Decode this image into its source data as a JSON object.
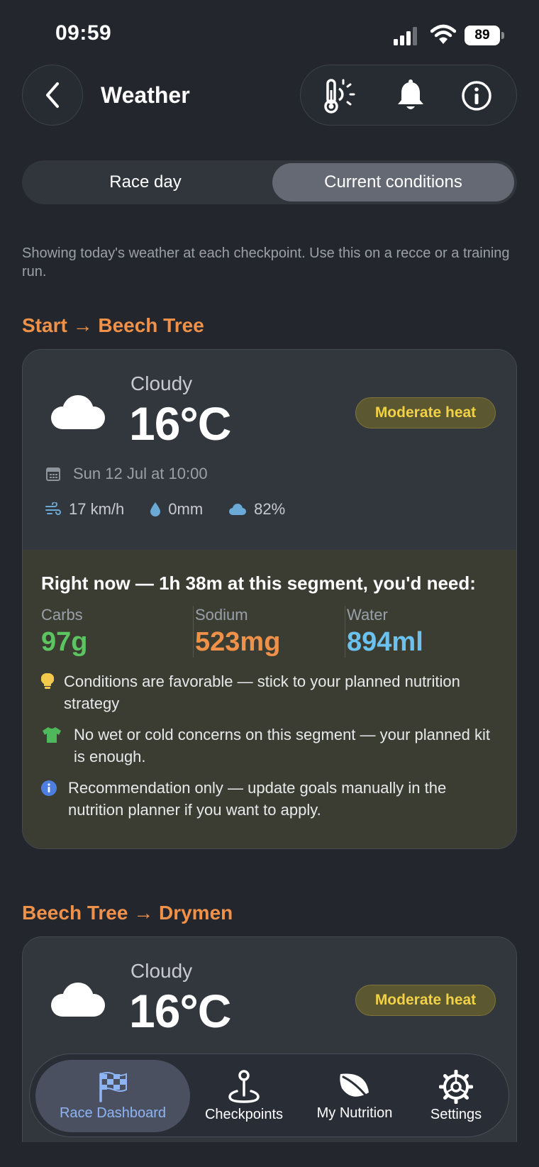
{
  "status": {
    "time": "09:59",
    "battery": "89"
  },
  "header": {
    "title": "Weather"
  },
  "segments": {
    "race_day": "Race day",
    "current": "Current conditions"
  },
  "intro": "Showing today's weather at each checkpoint. Use this on a recce or a training run.",
  "sections": [
    {
      "title": "Start → Beech Tree",
      "condition": "Cloudy",
      "temperature": "16°C",
      "badge": "Moderate heat",
      "date": "Sun 12 Jul at 10:00",
      "wind": "17 km/h",
      "rain": "0mm",
      "cloud": "82%",
      "need_title": "Right now — 1h 38m at this segment, you'd need:",
      "nutrients": [
        {
          "label": "Carbs",
          "value": "97g",
          "color": "#5cc461"
        },
        {
          "label": "Sodium",
          "value": "523mg",
          "color": "#f0914a"
        },
        {
          "label": "Water",
          "value": "894ml",
          "color": "#6cc2ef"
        }
      ],
      "tips": [
        "Conditions are favorable — stick to your planned nutrition strategy",
        "No wet or cold concerns on this segment — your planned kit is enough.",
        "Recommendation only — update goals manually in the nutrition planner if you want to apply."
      ]
    },
    {
      "title": "Beech Tree → Drymen",
      "condition": "Cloudy",
      "temperature": "16°C",
      "badge": "Moderate heat"
    }
  ],
  "tabs": {
    "race_dashboard": "Race Dashboard",
    "checkpoints": "Checkpoints",
    "nutrition": "My Nutrition",
    "settings": "Settings"
  },
  "icons": {
    "back": "chevron-left-icon",
    "heat": "thermometer-sun-icon",
    "notifications": "bell-icon",
    "info": "info-icon",
    "weather": "cloud-icon",
    "date": "calendar-icon",
    "wind": "wind-icon",
    "rain": "droplet-icon",
    "cloud_cover": "cloud-icon",
    "tip_1": "lightbulb-icon",
    "tip_2": "shirt-icon",
    "tip_3": "info-icon"
  },
  "colors": {
    "accent": "#f0914a",
    "active_tab": "#8db5f5",
    "badge_text": "#f2d147"
  }
}
